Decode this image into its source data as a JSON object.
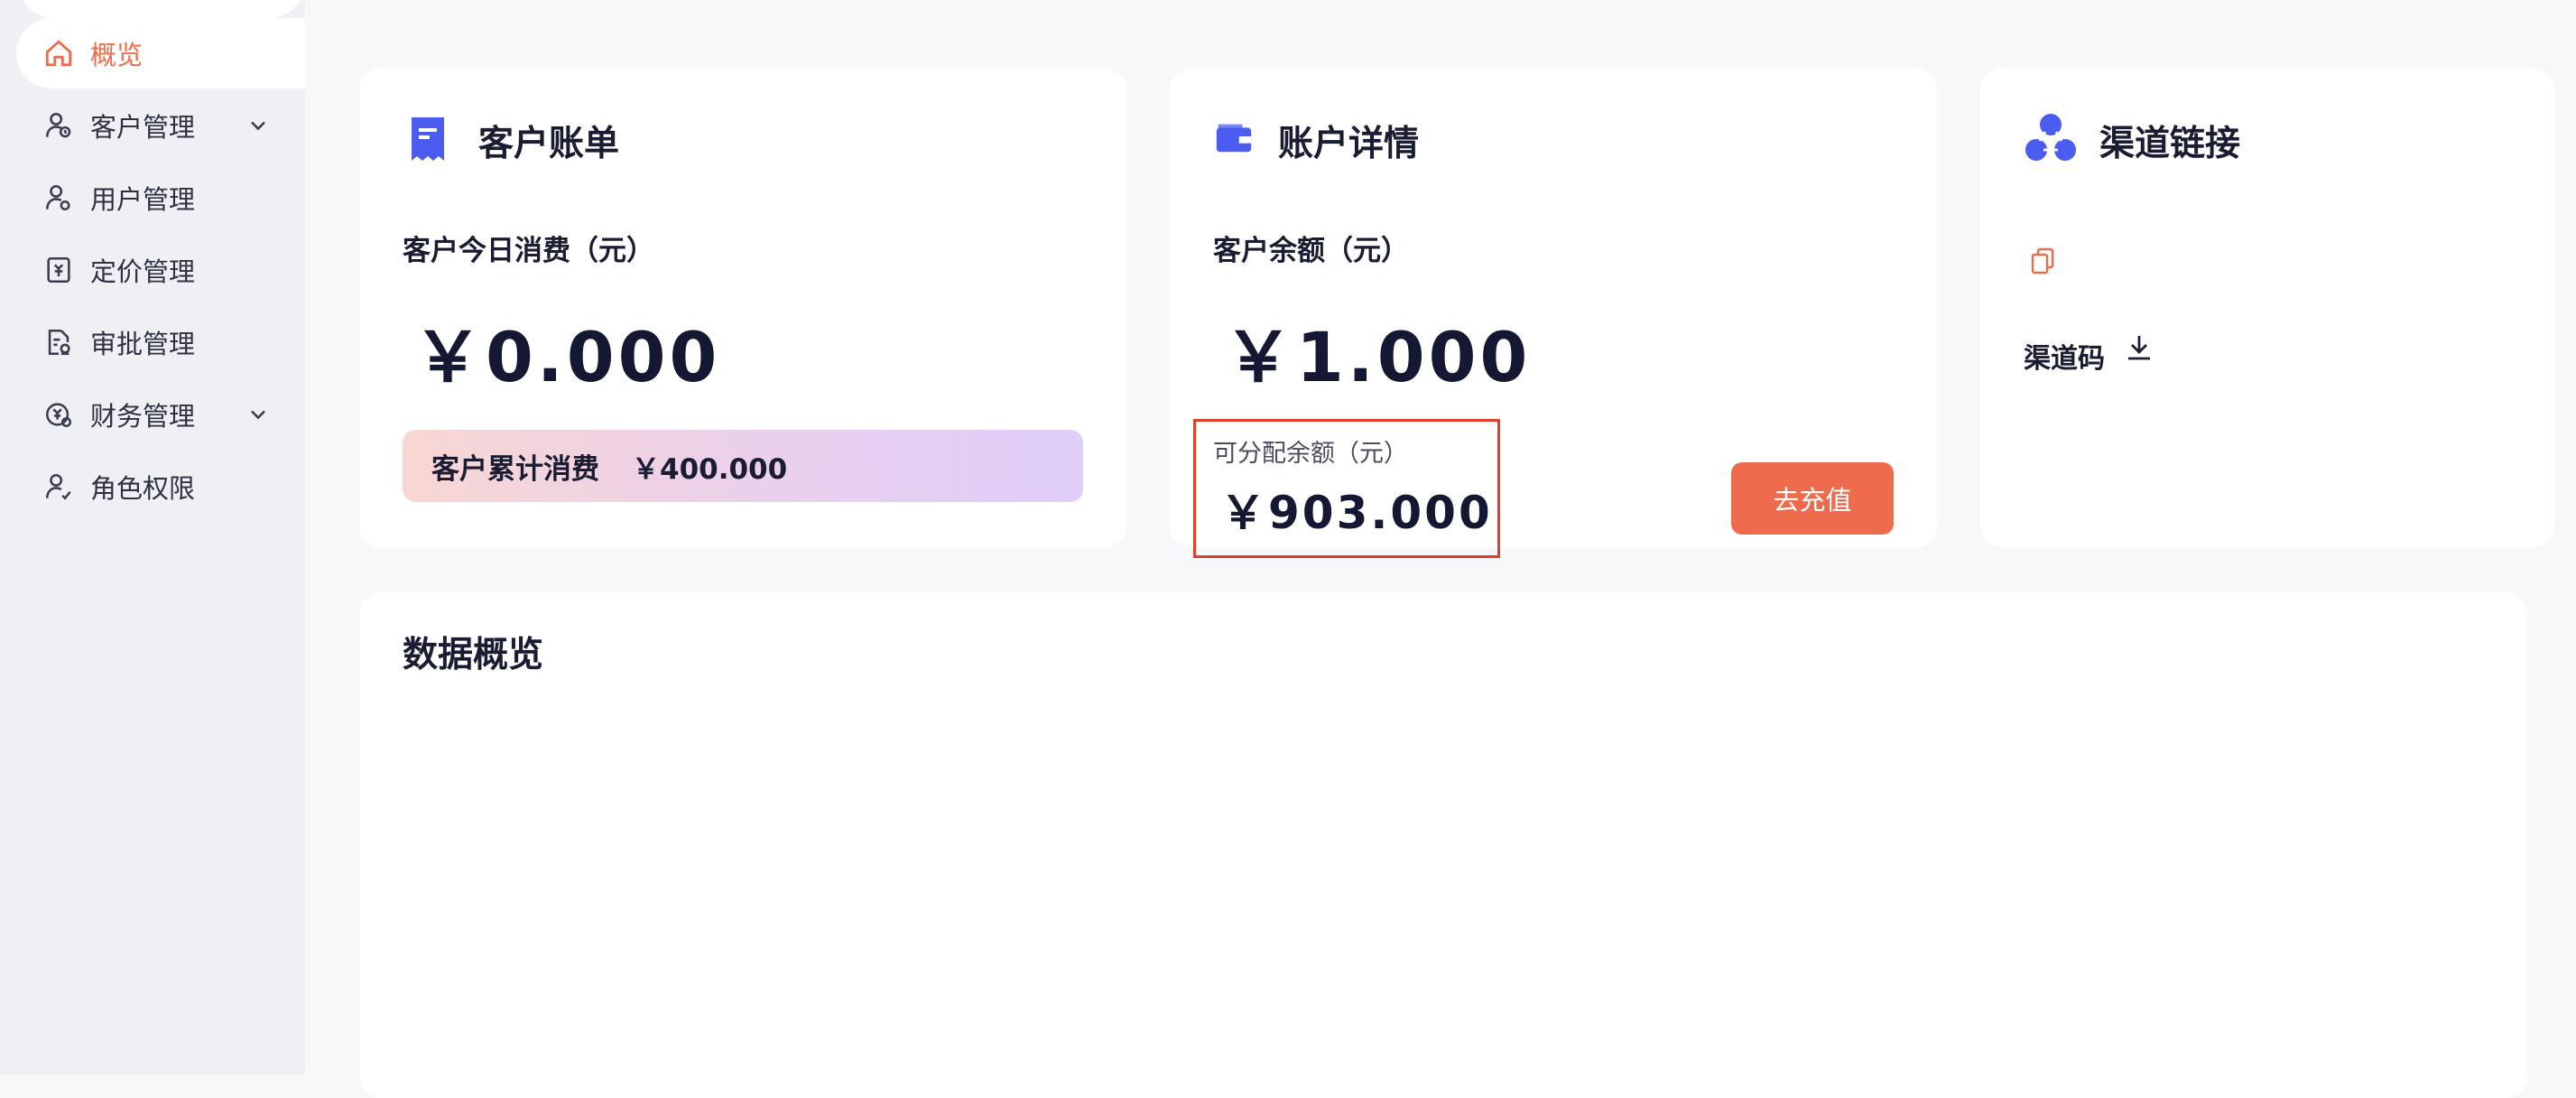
{
  "colors": {
    "accent": "#ef6b4d",
    "brand_blue": "#4b5cf0",
    "highlight": "#e0402a"
  },
  "sidebar": {
    "items": [
      {
        "label": "概览",
        "icon": "home-icon",
        "active": true
      },
      {
        "label": "客户管理",
        "icon": "customer-icon",
        "expandable": true
      },
      {
        "label": "用户管理",
        "icon": "user-icon"
      },
      {
        "label": "定价管理",
        "icon": "pricing-icon"
      },
      {
        "label": "审批管理",
        "icon": "approval-icon"
      },
      {
        "label": "财务管理",
        "icon": "finance-icon",
        "expandable": true
      },
      {
        "label": "角色权限",
        "icon": "role-icon"
      }
    ]
  },
  "bill_card": {
    "title": "客户账单",
    "today_label": "客户今日消费（元）",
    "today_amount": "￥0.000",
    "total_label": "客户累计消费",
    "total_amount": "￥400.000"
  },
  "account_card": {
    "title": "账户详情",
    "balance_label": "客户余额（元）",
    "balance_amount": "￥1.000",
    "allocatable_label": "可分配余额（元）",
    "allocatable_amount": "￥903.000",
    "recharge_button": "去充值"
  },
  "channel_card": {
    "title": "渠道链接",
    "code_label": "渠道码"
  },
  "overview_card": {
    "title": "数据概览"
  }
}
